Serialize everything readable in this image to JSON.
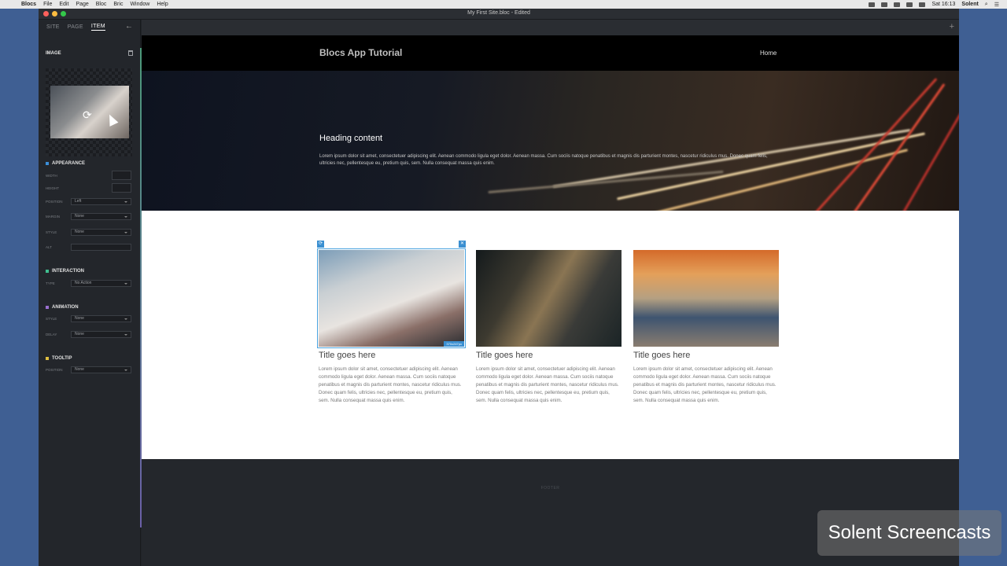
{
  "menubar": {
    "app": "Blocs",
    "items": [
      "File",
      "Edit",
      "Page",
      "Bloc",
      "Bric",
      "Window",
      "Help"
    ],
    "clock": "Sat 16:13",
    "user": "Solent"
  },
  "window": {
    "title": "My First Site.bloc - Edited"
  },
  "sidebar": {
    "tabs": [
      "SITE",
      "PAGE",
      "ITEM"
    ],
    "section_title": "IMAGE",
    "appearance": {
      "title": "APPEARANCE",
      "color": "#3b8ed8",
      "width_label": "WIDTH",
      "height_label": "HEIGHT",
      "position_label": "POSITION",
      "position_value": "Left",
      "margin_label": "MARGIN",
      "margin_value": "None",
      "style_label": "STYLE",
      "style_value": "None",
      "alt_label": "ALT"
    },
    "interaction": {
      "title": "INTERACTION",
      "color": "#3fbf8f",
      "type_label": "TYPE",
      "type_value": "No Action"
    },
    "animation": {
      "title": "ANIMATION",
      "color": "#9a6fd0",
      "style_label": "STYLE",
      "style_value": "None",
      "delay_label": "DELAY",
      "delay_value": "None"
    },
    "tooltip": {
      "title": "TOOLTIP",
      "color": "#e0c040",
      "position_label": "POSITION",
      "position_value": "None"
    }
  },
  "site": {
    "title": "Blocs App Tutorial",
    "nav": [
      "Home"
    ],
    "hero": {
      "heading": "Heading content",
      "text": "Lorem ipsum dolor sit amet, consectetuer adipiscing elit. Aenean commodo ligula eget dolor. Aenean massa. Cum sociis natoque penatibus et magnis dis parturient montes, nascetur ridiculus mus. Donec quam felis, ultricies nec, pellentesque eu, pretium quis, sem. Nulla consequat massa quis enim."
    },
    "cards": [
      {
        "title": "Title goes here",
        "body": "Lorem ipsum dolor sit amet, consectetuer adipiscing elit. Aenean commodo ligula eget dolor. Aenean massa. Cum sociis natoque penatibus et magnis dis parturient montes, nascetur ridiculus mus. Donec quam felis, ultricies nec, pellentesque eu, pretium quis, sem. Nulla consequat massa quis enim.",
        "size_tag": "370x247px"
      },
      {
        "title": "Title goes here",
        "body": "Lorem ipsum dolor sit amet, consectetuer adipiscing elit. Aenean commodo ligula eget dolor. Aenean massa. Cum sociis natoque penatibus et magnis dis parturient montes, nascetur ridiculus mus. Donec quam felis, ultricies nec, pellentesque eu, pretium quis, sem. Nulla consequat massa quis enim."
      },
      {
        "title": "Title goes here",
        "body": "Lorem ipsum dolor sit amet, consectetuer adipiscing elit. Aenean commodo ligula eget dolor. Aenean massa. Cum sociis natoque penatibus et magnis dis parturient montes, nascetur ridiculus mus. Donec quam felis, ultricies nec, pellentesque eu, pretium quis, sem. Nulla consequat massa quis enim."
      }
    ],
    "footer_label": "FOOTER"
  },
  "watermark": "Solent Screencasts"
}
